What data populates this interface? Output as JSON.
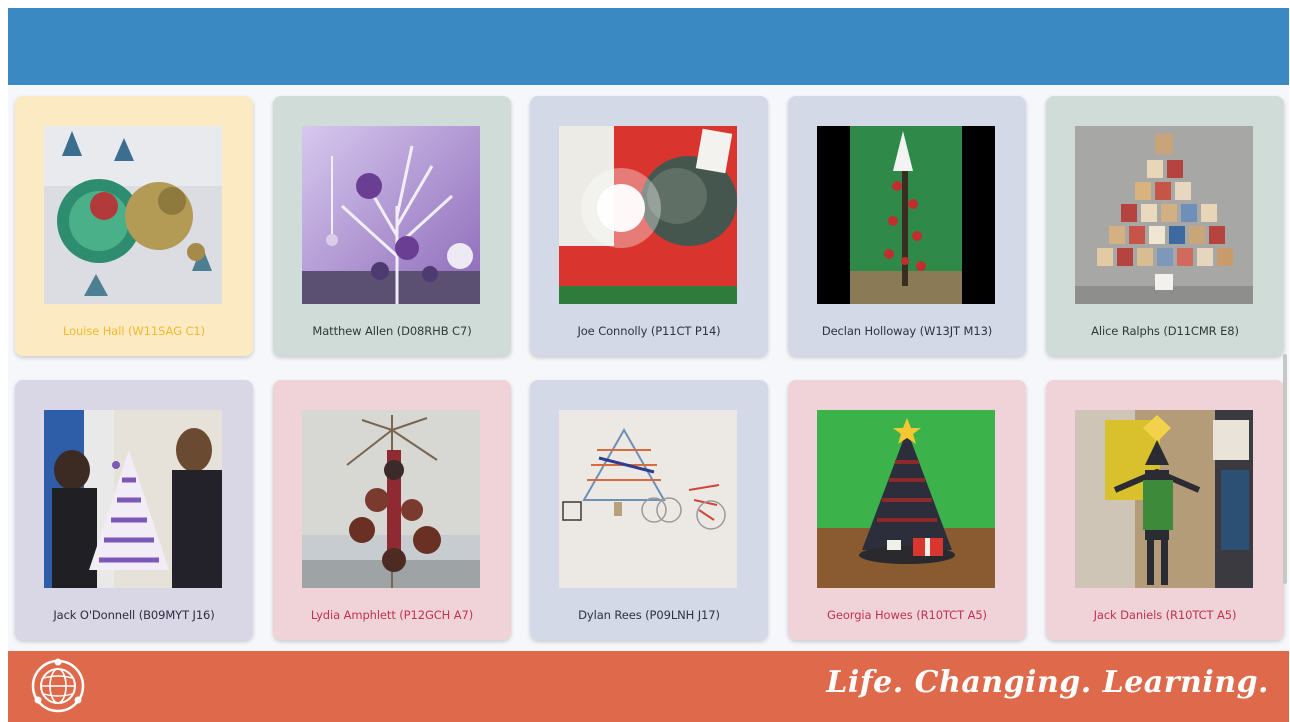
{
  "footer": {
    "tagline": "Life. Changing. Learning."
  },
  "cards": [
    {
      "name": "Louise Hall (W11SAG C1)",
      "bg": "#fcebc2",
      "text": "#f4b92e"
    },
    {
      "name": "Matthew Allen (D08RHB C7)",
      "bg": "#cfdcd8",
      "text": "#2e3b37"
    },
    {
      "name": "Joe Connolly (P11CT P14)",
      "bg": "#d3d9e6",
      "text": "#2c3442"
    },
    {
      "name": "Declan Holloway (W13JT M13)",
      "bg": "#d3d9e6",
      "text": "#2c3442"
    },
    {
      "name": "Alice Ralphs (D11CMR E8)",
      "bg": "#cfdcd8",
      "text": "#2e3b37"
    },
    {
      "name": "Jack O'Donnell (B09MYT J16)",
      "bg": "#d9d6e6",
      "text": "#2e2c3e"
    },
    {
      "name": "Lydia Amphlett (P12GCH A7)",
      "bg": "#f0d3d9",
      "text": "#c0334e"
    },
    {
      "name": "Dylan Rees (P09LNH J17)",
      "bg": "#d3d9e6",
      "text": "#2c3442"
    },
    {
      "name": "Georgia Howes (R10TCT A5)",
      "bg": "#f0d3d9",
      "text": "#c0334e"
    },
    {
      "name": "Jack Daniels (R10TCT A5)",
      "bg": "#f0d3d9",
      "text": "#c0334e"
    }
  ]
}
